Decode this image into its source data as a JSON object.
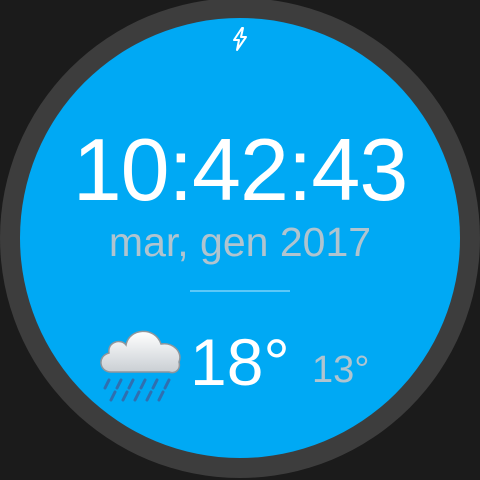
{
  "watchface": {
    "time": "10:42:43",
    "date": "mar, gen 2017",
    "status_icon": "charging-bolt-icon",
    "weather": {
      "icon": "rain-cloud-icon",
      "temp_high": "18°",
      "temp_low": "13°"
    },
    "colors": {
      "face": "#00a9f4",
      "bezel": "#3d3d3d",
      "background": "#1b1b1b",
      "primary_text": "#ffffff",
      "secondary_text": "#b0c4cf"
    }
  }
}
